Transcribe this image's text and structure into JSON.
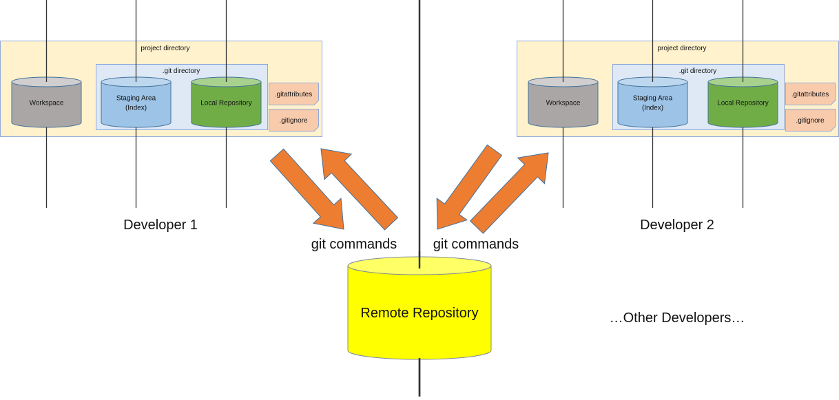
{
  "developers": [
    {
      "label": "Developer 1",
      "project_directory": "project directory",
      "git_directory": ".git directory",
      "workspace": "Workspace",
      "staging_area": [
        "Staging Area",
        "(Index)"
      ],
      "local_repository": "Local Repository",
      "files": [
        ".gitattributes",
        ".gitignore"
      ]
    },
    {
      "label": "Developer 2",
      "project_directory": "project directory",
      "git_directory": ".git directory",
      "workspace": "Workspace",
      "staging_area": [
        "Staging Area",
        "(Index)"
      ],
      "local_repository": "Local Repository",
      "files": [
        ".gitattributes",
        ".gitignore"
      ]
    }
  ],
  "git_commands_left": "git commands",
  "git_commands_right": "git commands",
  "remote_repository": "Remote Repository",
  "other_developers": "…Other Developers…",
  "colors": {
    "project_box": "#fff2cc",
    "git_box": "#dfe9f5",
    "workspace": "#aaa6a6",
    "staging": "#9dc3e6",
    "local_repo": "#70ad47",
    "file_note": "#f8cbad",
    "arrow": "#ed7d31",
    "remote": "#ffff00"
  }
}
